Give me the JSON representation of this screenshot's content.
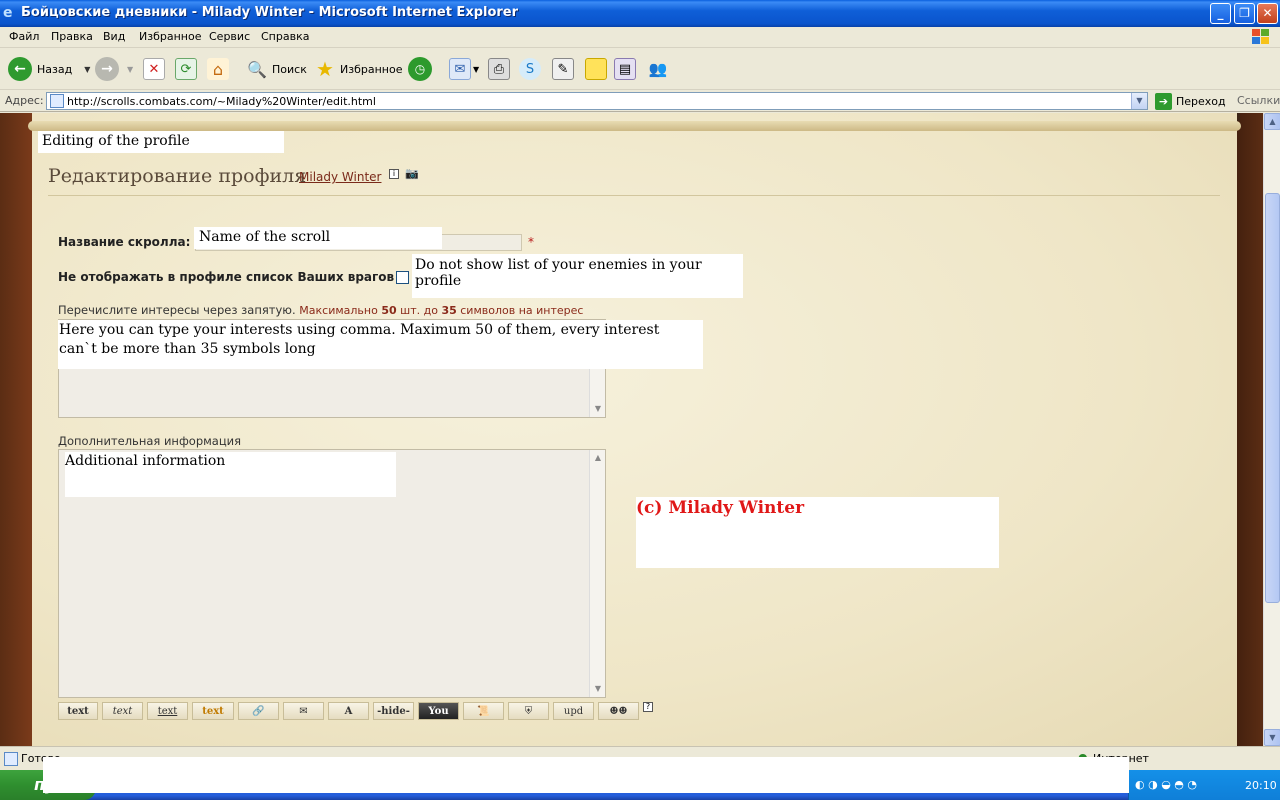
{
  "window": {
    "title": "Бойцовские дневники - Milady Winter - Microsoft Internet Explorer",
    "minimize": "_",
    "maximize": "❐",
    "close": "✕"
  },
  "menu": [
    "Файл",
    "Правка",
    "Вид",
    "Избранное",
    "Сервис",
    "Справка"
  ],
  "toolbar": {
    "back_label": "Назад",
    "search_label": "Поиск",
    "favorites_label": "Избранное"
  },
  "address": {
    "label": "Адрес:",
    "url": "http://scrolls.combats.com/~Milady%20Winter/edit.html",
    "go_label": "Переход",
    "links_label": "Ссылки"
  },
  "page": {
    "caption_editing": "Editing of the profile",
    "heading": "Редактирование профиля",
    "user_link": "Milady Winter",
    "scroll_name_label": "Название скролла:",
    "scroll_name_caption": "Name of the scroll",
    "required_mark": "*",
    "enemies_label": "Не отображать в профиле список Ваших врагов",
    "enemies_caption": "Do not show list of your enemies in your profile",
    "interests_label": "Перечислите интересы через запятую.",
    "interests_hint_a": "Максимально",
    "interests_hint_max": "50",
    "interests_hint_b": "шт. до",
    "interests_hint_len": "35",
    "interests_hint_c": "символов на интерес",
    "interests_caption": "Here you can type your interests using comma. Maximum 50 of them, every interest can`t be more than 35 symbols long",
    "additional_label": "Дополнительная информация",
    "additional_caption": "Additional information",
    "copyright": "(c) Milady Winter",
    "format_buttons": [
      "text",
      "text",
      "text",
      "text",
      "",
      "",
      "A",
      "-hide-",
      "You",
      "",
      "",
      "upd",
      "",
      "?"
    ]
  },
  "status": {
    "left": "Готово",
    "zone": "Интернет"
  },
  "taskbar": {
    "start": "пуск",
    "clock": "20:10"
  }
}
